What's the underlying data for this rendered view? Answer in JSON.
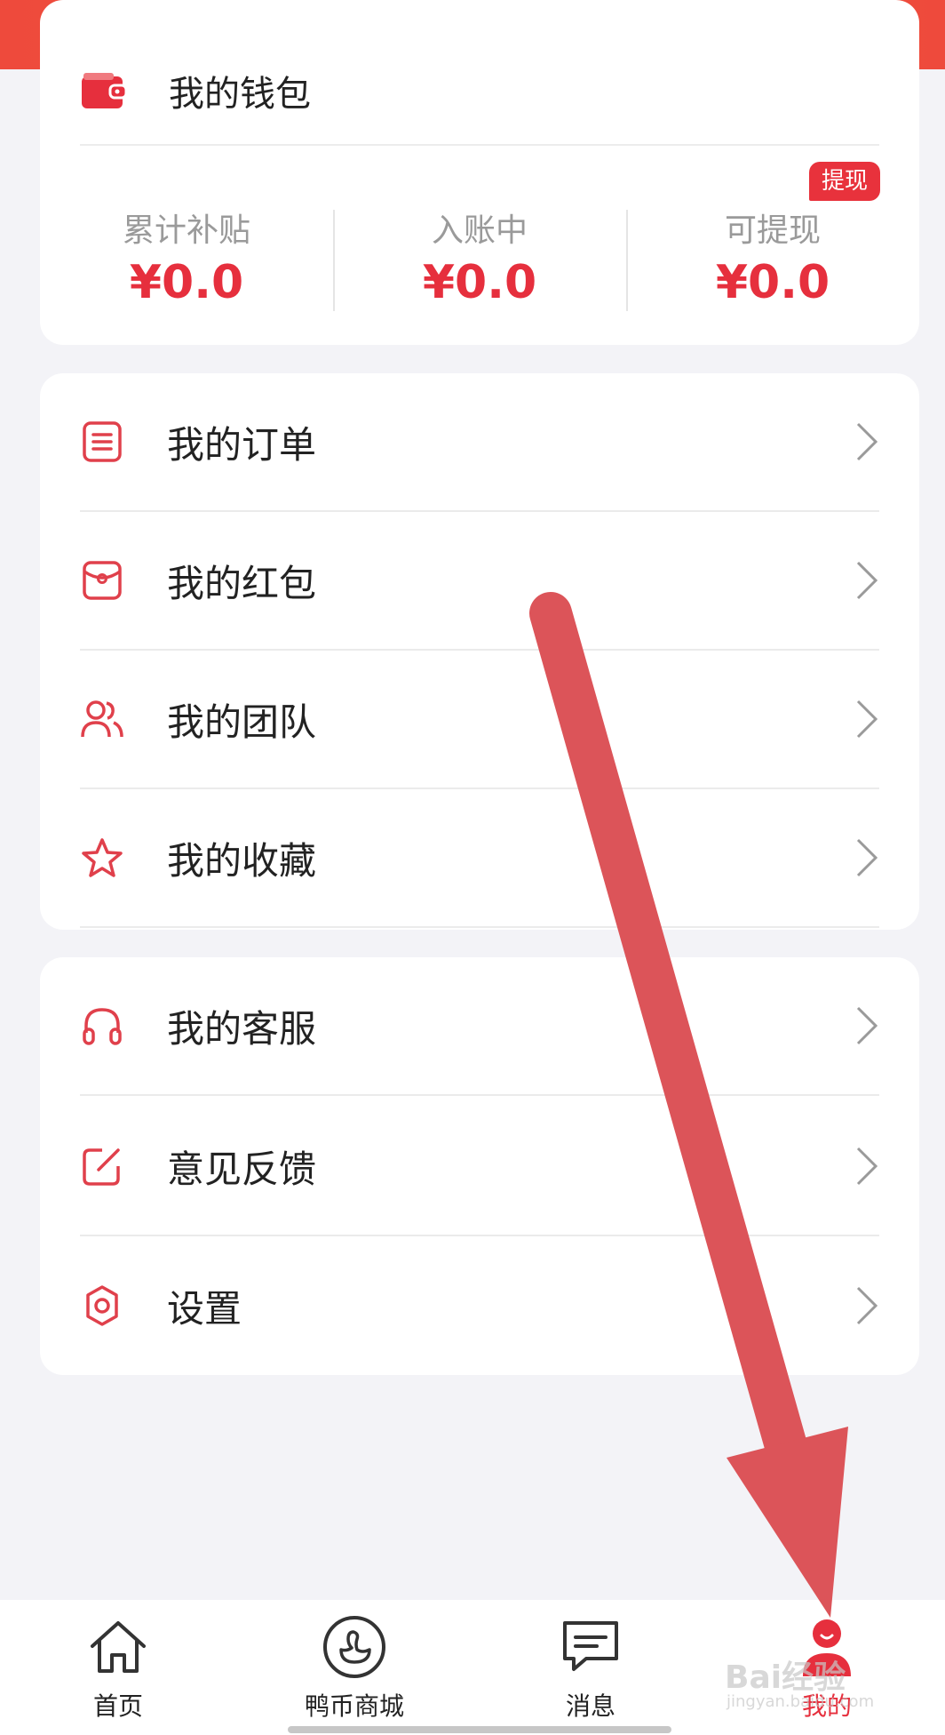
{
  "wallet": {
    "title": "我的钱包",
    "withdraw_badge": "提现",
    "stats": [
      {
        "label": "累计补贴",
        "value": "¥0.0"
      },
      {
        "label": "入账中",
        "value": "¥0.0"
      },
      {
        "label": "可提现",
        "value": "¥0.0"
      }
    ]
  },
  "menu_group_1": [
    {
      "label": "我的订单",
      "icon": "order-list-icon"
    },
    {
      "label": "我的红包",
      "icon": "red-envelope-icon"
    },
    {
      "label": "我的团队",
      "icon": "team-icon"
    },
    {
      "label": "我的收藏",
      "icon": "star-icon"
    }
  ],
  "menu_group_2": [
    {
      "label": "我的客服",
      "icon": "headset-icon"
    },
    {
      "label": "意见反馈",
      "icon": "edit-icon"
    },
    {
      "label": "设置",
      "icon": "gear-icon"
    }
  ],
  "tabbar": [
    {
      "label": "首页",
      "icon": "home-icon"
    },
    {
      "label": "鸭币商城",
      "icon": "duck-icon"
    },
    {
      "label": "消息",
      "icon": "message-icon"
    },
    {
      "label": "我的",
      "icon": "profile-icon",
      "active": true
    }
  ],
  "watermark": {
    "text": "Bai经验",
    "sub": "jingyan.baidu.com"
  },
  "colors": {
    "accent": "#e62f3d",
    "arrow": "#dc5459",
    "header": "#ee4a3c"
  }
}
